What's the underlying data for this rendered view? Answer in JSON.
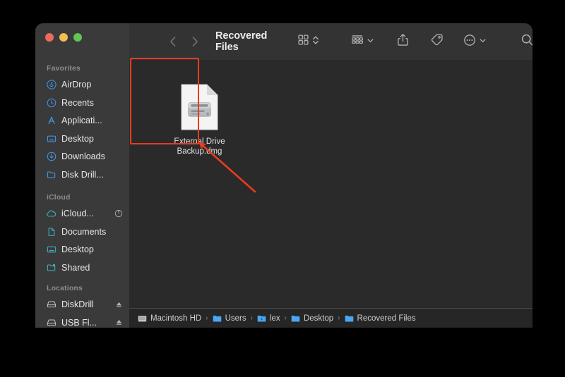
{
  "window": {
    "title": "Recovered Files",
    "traffic_lights": [
      {
        "name": "close",
        "color": "#ed6a5e"
      },
      {
        "name": "minimize",
        "color": "#f4be4f"
      },
      {
        "name": "maximize",
        "color": "#61c454"
      }
    ]
  },
  "toolbar": {
    "back_icon": "chevron-left-icon",
    "forward_icon": "chevron-right-icon",
    "view_mode_icon": "icon-view-grid-icon",
    "group_by_icon": "group-by-icon",
    "share_icon": "share-icon",
    "tag_icon": "tag-icon",
    "more_icon": "more-ellipsis-icon",
    "search_icon": "search-icon"
  },
  "sidebar": {
    "sections": [
      {
        "header": "Favorites",
        "items": [
          {
            "label": "AirDrop",
            "icon": "airdrop-icon",
            "color": "blue"
          },
          {
            "label": "Recents",
            "icon": "clock-icon",
            "color": "blue"
          },
          {
            "label": "Applicati...",
            "icon": "applications-icon",
            "color": "blue"
          },
          {
            "label": "Desktop",
            "icon": "desktop-icon",
            "color": "blue"
          },
          {
            "label": "Downloads",
            "icon": "downloads-icon",
            "color": "blue"
          },
          {
            "label": "Disk Drill...",
            "icon": "folder-icon",
            "color": "blue"
          }
        ]
      },
      {
        "header": "iCloud",
        "items": [
          {
            "label": "iCloud...",
            "icon": "icloud-icon",
            "color": "teal",
            "trailing": "progress-circle-icon"
          },
          {
            "label": "Documents",
            "icon": "document-icon",
            "color": "teal"
          },
          {
            "label": "Desktop",
            "icon": "desktop-icon",
            "color": "teal"
          },
          {
            "label": "Shared",
            "icon": "shared-folder-icon",
            "color": "teal"
          }
        ]
      },
      {
        "header": "Locations",
        "items": [
          {
            "label": "DiskDrill",
            "icon": "drive-icon",
            "color": "grey",
            "trailing": "eject-icon"
          },
          {
            "label": "USB Fl...",
            "icon": "drive-icon",
            "color": "grey",
            "trailing": "eject-icon"
          }
        ]
      }
    ]
  },
  "content": {
    "files": [
      {
        "name_line1": "External Drive",
        "name_line2": "Backup.dmg",
        "icon": "dmg-disk-image-icon"
      }
    ]
  },
  "annotation": {
    "highlight_color": "#e83c20",
    "arrow_color": "#e83c20",
    "target": "External Drive Backup.dmg"
  },
  "pathbar": {
    "crumbs": [
      {
        "label": "Macintosh HD",
        "icon": "hard-drive-icon"
      },
      {
        "label": "Users",
        "icon": "folder-icon"
      },
      {
        "label": "lex",
        "icon": "home-folder-icon"
      },
      {
        "label": "Desktop",
        "icon": "folder-icon"
      },
      {
        "label": "Recovered Files",
        "icon": "folder-icon"
      }
    ],
    "separator": "›"
  }
}
